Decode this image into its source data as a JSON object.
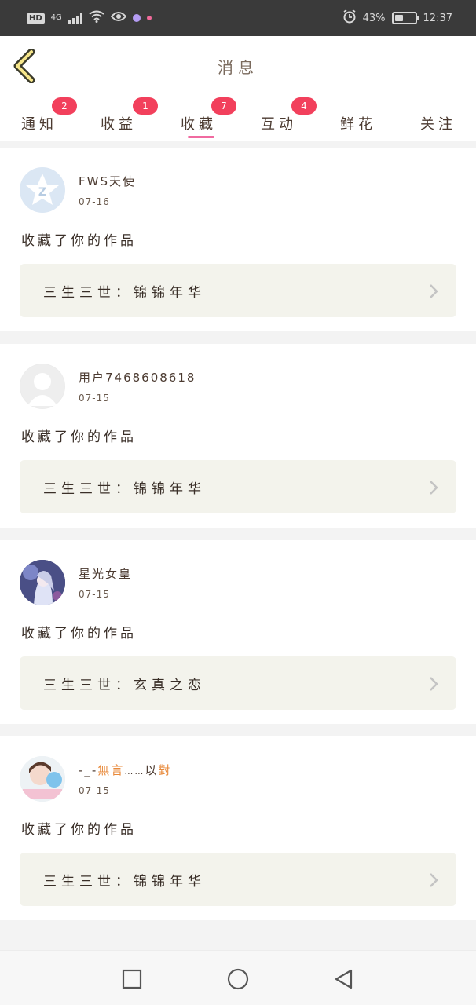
{
  "status_bar": {
    "hd": "HD",
    "network": "4G",
    "battery_percent": "43%",
    "battery_level": 0.43,
    "time": "12:37",
    "icons": [
      "wifi-icon",
      "eye-icon",
      "alarm-icon"
    ]
  },
  "header": {
    "title": "消息",
    "back_icon": "chevron-left-icon"
  },
  "tabs": [
    {
      "label": "通知",
      "badge": "2",
      "active": false
    },
    {
      "label": "收益",
      "badge": "1",
      "active": false
    },
    {
      "label": "收藏",
      "badge": "7",
      "active": true
    },
    {
      "label": "互动",
      "badge": "4",
      "active": false
    },
    {
      "label": "鲜花",
      "badge": "",
      "active": false
    },
    {
      "label": "关注",
      "badge": "",
      "active": false
    }
  ],
  "messages": [
    {
      "username": "FWS天使",
      "date": "07-16",
      "action": "收藏了你的作品",
      "work": "三生三世：锦锦年华",
      "avatar": "qq-default-avatar"
    },
    {
      "username": "用户7468608618",
      "date": "07-15",
      "action": "收藏了你的作品",
      "work": "三生三世：锦锦年华",
      "avatar": "default-person-avatar"
    },
    {
      "username": "星光女皇",
      "date": "07-15",
      "action": "收藏了你的作品",
      "work": "三生三世：玄真之恋",
      "avatar": "anime-avatar"
    },
    {
      "username_prefix": "-_-",
      "username_mid": "無言",
      "username_dots": "……",
      "username_suffix_a": "以",
      "username_suffix_b": "對",
      "date": "07-15",
      "action": "收藏了你的作品",
      "work": "三生三世：锦锦年华",
      "avatar": "photo-avatar"
    }
  ],
  "colors": {
    "badge": "#f2405c",
    "tab_underline": "#f06aa0",
    "highlight_name": "#e8893a",
    "card_box": "#f3f3ec"
  },
  "nav_bar": [
    "recent-apps-icon",
    "home-icon",
    "back-icon"
  ]
}
